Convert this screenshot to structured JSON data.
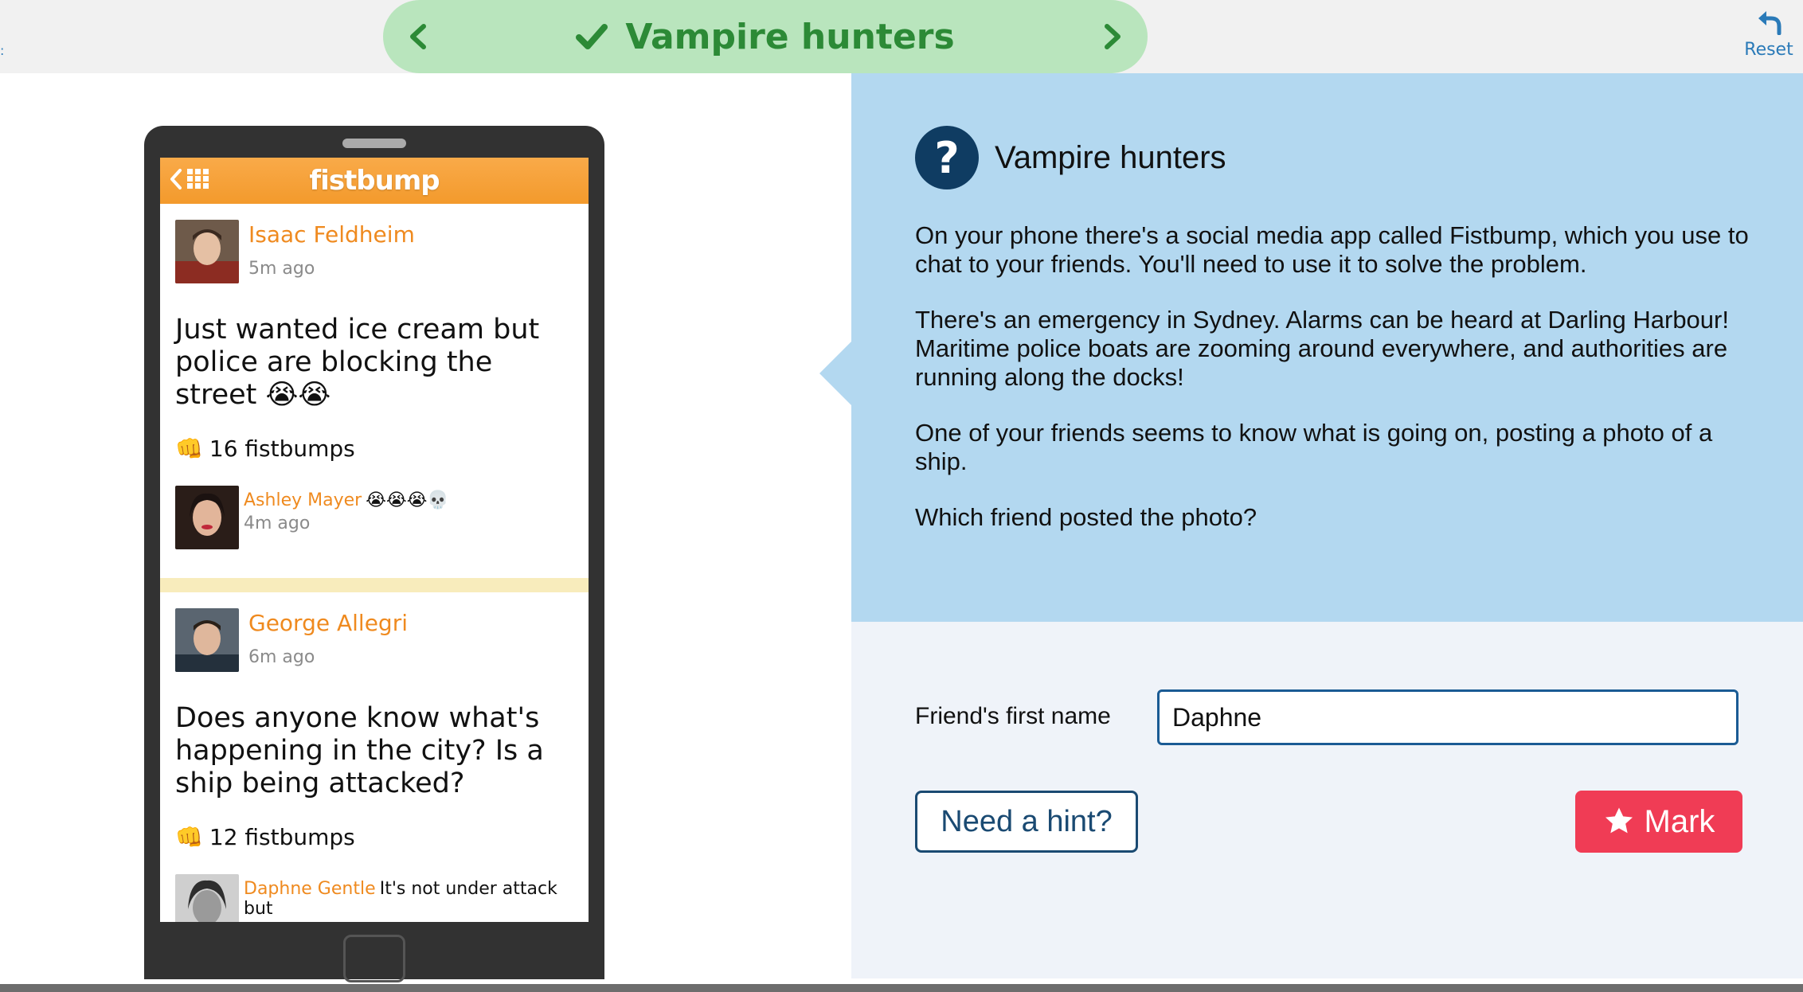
{
  "top_bar": {
    "title": "Vampire hunters",
    "reset_label": "Reset",
    "left_edge_glyph": ":"
  },
  "icons": {
    "prev": "chevron-left-icon",
    "next": "chevron-right-icon",
    "check": "check-icon",
    "reset": "undo-arrow-icon",
    "question": "question-mark-icon",
    "star": "star-icon",
    "fist": "fist-icon",
    "grid": "grid-icon"
  },
  "colors": {
    "title_pill_bg": "#b9e5bd",
    "title_text": "#2c8a36",
    "app_header": "#f39a2c",
    "author": "#ef8a1f",
    "question_panel": "#b3d8f0",
    "mark_button": "#f03c55"
  },
  "phone": {
    "app_name": "fistbump",
    "posts": [
      {
        "author": "Isaac Feldheim",
        "time": "5m ago",
        "text": "Just wanted ice cream but police are blocking the street 😭😭",
        "likes": "16 fistbumps",
        "comment": {
          "author": "Ashley Mayer",
          "text": "😭😭😭💀",
          "time": "4m ago"
        }
      },
      {
        "author": "George Allegri",
        "time": "6m ago",
        "text": "Does anyone know what's happening in the city? Is a ship being attacked?",
        "likes": "12 fistbumps",
        "comment": {
          "author": "Daphne Gentle",
          "text": "It's not under attack but"
        }
      }
    ]
  },
  "question": {
    "title": "Vampire hunters",
    "paragraphs": [
      "On your phone there's a social media app called Fistbump, which you use to chat to your friends. You'll need to use it to solve the problem.",
      "There's an emergency in Sydney. Alarms can be heard at Darling Harbour! Maritime police boats are zooming around everywhere, and authorities are running along the docks!",
      "One of your friends seems to know what is going on, posting a photo of a ship.",
      "Which friend posted the photo?"
    ]
  },
  "answer": {
    "label": "Friend's first name",
    "value": "Daphne",
    "hint_label": "Need a hint?",
    "mark_label": "Mark"
  }
}
